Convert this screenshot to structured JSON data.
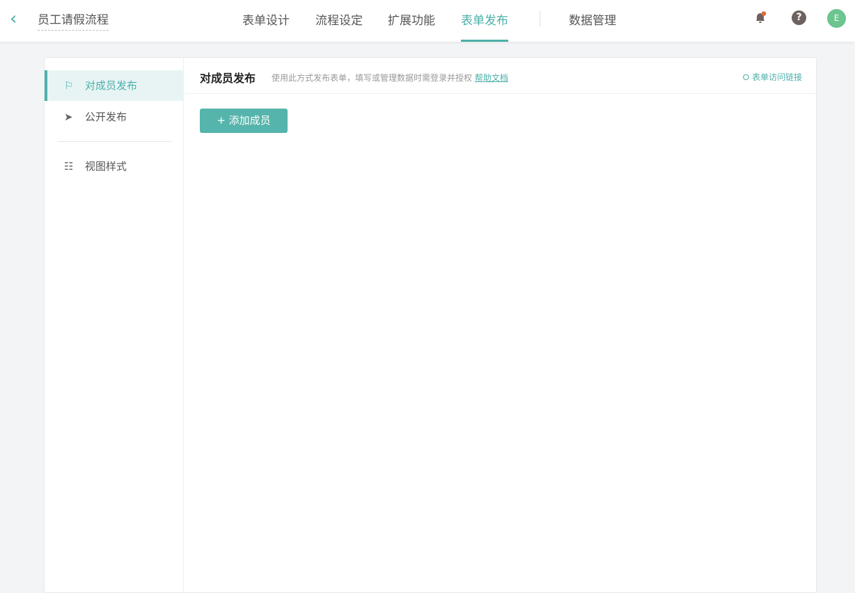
{
  "header": {
    "title": "员工请假流程",
    "tabs": [
      "表单设计",
      "流程设定",
      "扩展功能",
      "表单发布",
      "数据管理"
    ],
    "avatar": "E",
    "help": "?"
  },
  "sidebar": {
    "items": [
      "对成员发布",
      "公开发布",
      "视图样式"
    ]
  },
  "main": {
    "title": "对成员发布",
    "description": "使用此方式发布表单，填写或管理数据时需登录并授权",
    "help_link": "帮助文档",
    "access_link": "表单访问链接",
    "add_button": "添加成员",
    "add_icon": "+"
  },
  "colors": {
    "accent": "#4cb0a8"
  }
}
